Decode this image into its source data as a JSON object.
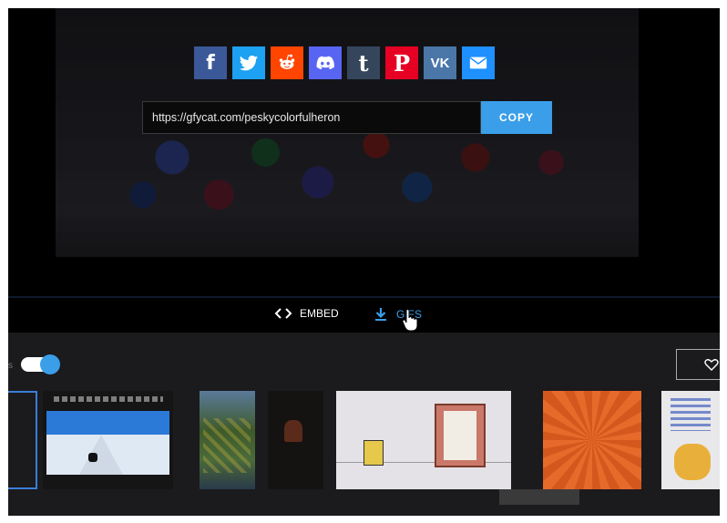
{
  "share": {
    "buttons": [
      {
        "name": "facebook",
        "glyph": "f",
        "color": "#3b5998"
      },
      {
        "name": "twitter",
        "glyph": "",
        "color": "#1da1f2"
      },
      {
        "name": "reddit",
        "glyph": "",
        "color": "#ff4500"
      },
      {
        "name": "discord",
        "glyph": "",
        "color": "#5865f2"
      },
      {
        "name": "tumblr",
        "glyph": "t",
        "color": "#35465c"
      },
      {
        "name": "pinterest",
        "glyph": "P",
        "color": "#e60023"
      },
      {
        "name": "vk",
        "glyph": "VK",
        "color": "#4a76a8"
      },
      {
        "name": "email",
        "glyph": "",
        "color": "#1e90ff"
      }
    ]
  },
  "url": {
    "value": "https://gfycat.com/peskycolorfulheron",
    "copy_label": "COPY"
  },
  "actions": {
    "embed_label": "EMBED",
    "gifs_label": "GIFS",
    "accent": "#3a9ee8"
  },
  "toggle": {
    "state": "on"
  }
}
